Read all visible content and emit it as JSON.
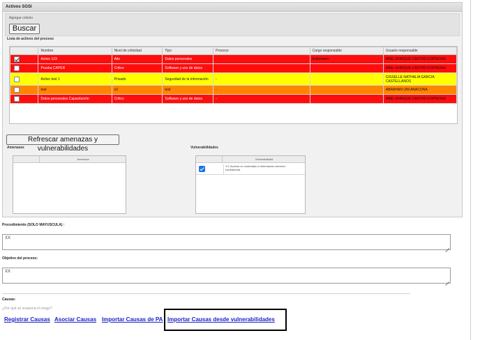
{
  "panel": {
    "title": "Activos SGSI",
    "criteria_label": "Agregar criterio",
    "search_button": "Buscar",
    "list_title": "Lista de activos del proceso"
  },
  "assets_table": {
    "headers": [
      "",
      "Nombre",
      "Nivel de criticidad",
      "Tipo",
      "Proceso",
      "Cargo responsable",
      "Usuario responsable"
    ],
    "rows": [
      {
        "checked": true,
        "color": "#ff0d0d",
        "nombre": "Activo 123",
        "nivel": "Alto",
        "tipo": "Datos personales",
        "proceso": "",
        "cargo": "Enfermero",
        "usuario": "ABEL ENRIQUE CASTRO ESPINOSA"
      },
      {
        "checked": false,
        "color": "#ff0d0d",
        "nombre": "Prueba CAPER",
        "nivel": "Critico",
        "tipo": "Software y uso de datos",
        "proceso": "",
        "cargo": "",
        "usuario": "ABEL ENRIQUE CASTRO ESPINOSA"
      },
      {
        "checked": false,
        "color": "#ffff00",
        "nombre": "Activo test 1",
        "nivel": "Privado",
        "tipo": "Seguridad de la información",
        "proceso": "-",
        "cargo": "",
        "usuario": "GISSELLE NATHALIA GARCIA CASTELLANOS"
      },
      {
        "checked": false,
        "color": "#ff8400",
        "nombre": "test",
        "nivel": "n2",
        "tipo": "test",
        "proceso": "-",
        "cargo": "",
        "usuario": "ABRAHAN UNI ANACONA"
      },
      {
        "checked": false,
        "color": "#ff0d0d",
        "nombre": "Datos personales Capacitación",
        "nivel": "Critico",
        "tipo": "Software y uso de datos",
        "proceso": "-",
        "cargo": "",
        "usuario": "ABEL ENRIQUE CASTRO ESPINOSA"
      }
    ]
  },
  "refresh_button": "Refrescar amenazas y vulnerabilidades",
  "threats": {
    "title": "Amenazas",
    "column": "Amenaza"
  },
  "vulnerabilities": {
    "title": "Vulnerabilidades",
    "column": "Vulnerabilidad",
    "rows": [
      {
        "checked": true,
        "text": "V.1-Acceso no controlado a información secreta / confidencial."
      }
    ]
  },
  "procedure": {
    "label": "Procedimiento (SOLO MAYUSCULA) :",
    "value": "XX"
  },
  "objective": {
    "label": "Objetivo del proceso:",
    "value": "XX"
  },
  "causes": {
    "label": "Causas:",
    "question": "¿Por qué se ocasiona el riesgo?",
    "links": [
      "Registrar Causas",
      "Asociar Causas",
      "Importar Causas de PA",
      "Importar Causas desde vulnerabilidades"
    ]
  }
}
